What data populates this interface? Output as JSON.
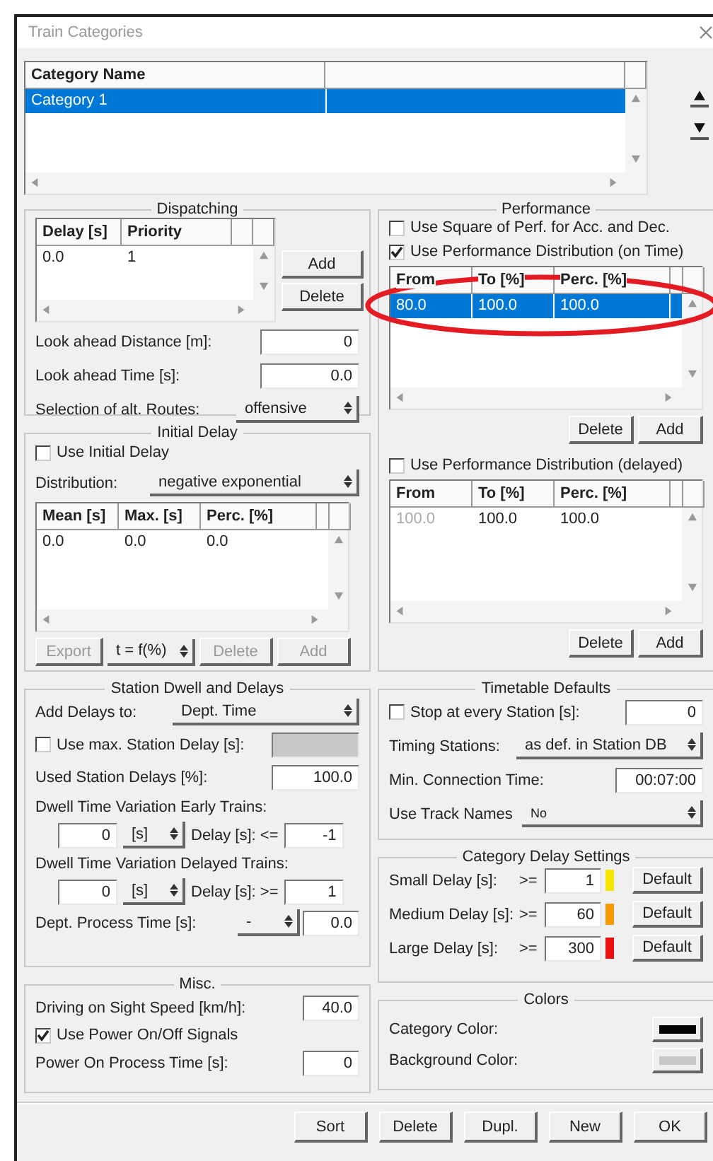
{
  "window": {
    "title": "Train Categories"
  },
  "categories": {
    "columns": [
      "Category Name"
    ],
    "rows": [
      {
        "cells": [
          "Category 1"
        ],
        "selected": true
      }
    ]
  },
  "dispatching": {
    "title": "Dispatching",
    "columns": [
      "Delay [s]",
      "Priority"
    ],
    "rows": [
      {
        "cells": [
          "0.0",
          "1"
        ],
        "selected": false
      }
    ],
    "buttons": [
      "Add",
      "Delete"
    ],
    "fields": [
      {
        "label": "Look ahead Distance [m]:",
        "value": "0"
      },
      {
        "label": "Look ahead Time [s]:",
        "value": "0.0"
      }
    ],
    "routes": {
      "label": "Selection of alt. Routes:",
      "value": "offensive"
    }
  },
  "initial_delay": {
    "title": "Initial Delay",
    "use": {
      "label": "Use Initial Delay",
      "checked": false
    },
    "distribution": {
      "label": "Distribution:",
      "value": "negative exponential"
    },
    "columns": [
      "Mean [s]",
      "Max. [s]",
      "Perc. [%]"
    ],
    "rows": [
      {
        "cells": [
          "0.0",
          "0.0",
          "0.0"
        ],
        "selected": false
      }
    ],
    "toolbar": [
      {
        "kind": "button",
        "label": "Export",
        "disabled": true
      },
      {
        "kind": "select",
        "label": "t = f(%)",
        "disabled": false
      },
      {
        "kind": "button",
        "label": "Delete",
        "disabled": true
      },
      {
        "kind": "button",
        "label": "Add",
        "disabled": true
      }
    ]
  },
  "performance": {
    "title": "Performance",
    "square": {
      "label": "Use Square of Perf. for Acc. and Dec.",
      "checked": false
    },
    "on_time": {
      "label": "Use Performance Distribution (on Time)",
      "checked": true,
      "columns": [
        "From",
        "To [%]",
        "Perc. [%]"
      ],
      "rows": [
        {
          "cells": [
            "80.0",
            "100.0",
            "100.0"
          ],
          "selected": true,
          "first_cell_disabled": false
        }
      ],
      "buttons": [
        "Delete",
        "Add"
      ]
    },
    "delayed": {
      "label": "Use Performance Distribution (delayed)",
      "checked": false,
      "columns": [
        "From",
        "To [%]",
        "Perc. [%]"
      ],
      "rows": [
        {
          "cells": [
            "100.0",
            "100.0",
            "100.0"
          ],
          "selected": false,
          "first_cell_disabled": true
        }
      ],
      "buttons": [
        "Delete",
        "Add"
      ]
    }
  },
  "station_dwell": {
    "title": "Station Dwell and Delays",
    "add_delays": {
      "label": "Add Delays to:",
      "value": "Dept. Time"
    },
    "max_delay": {
      "label": "Use max. Station Delay [s]:",
      "checked": false
    },
    "used": {
      "label": "Used Station Delays [%]:",
      "value": "100.0"
    },
    "variations": [
      {
        "label": "Dwell Time Variation Early Trains:",
        "value": "0",
        "unit": "[s]",
        "delay_label": "Delay [s]: <=",
        "delay_value": "-1"
      },
      {
        "label": "Dwell Time Variation Delayed Trains:",
        "value": "0",
        "unit": "[s]",
        "delay_label": "Delay [s]: >=",
        "delay_value": "1"
      }
    ],
    "process": {
      "label": "Dept. Process Time [s]:",
      "select": "-",
      "value": "0.0"
    }
  },
  "misc": {
    "title": "Misc.",
    "speed": {
      "label": "Driving on Sight Speed [km/h]:",
      "value": "40.0"
    },
    "power_signals": {
      "label": "Use Power On/Off Signals",
      "checked": true
    },
    "power_time": {
      "label": "Power On Process Time [s]:",
      "value": "0"
    }
  },
  "timetable": {
    "title": "Timetable Defaults",
    "stop": {
      "label": "Stop at every Station [s]:",
      "checked": false,
      "value": "0"
    },
    "timing": {
      "label": "Timing Stations:",
      "value": "as def. in Station DB"
    },
    "min_connection": {
      "label": "Min. Connection Time:",
      "value": "00:07:00"
    },
    "track_names": {
      "label": "Use Track Names",
      "value": "No"
    }
  },
  "delay_settings": {
    "title": "Category Delay Settings",
    "rows": [
      {
        "label": "Small Delay [s]:",
        "op": ">=",
        "value": "1",
        "color": "#f5e800",
        "button": "Default"
      },
      {
        "label": "Medium Delay [s]:",
        "op": ">=",
        "value": "60",
        "color": "#f59a00",
        "button": "Default"
      },
      {
        "label": "Large Delay [s]:",
        "op": ">=",
        "value": "300",
        "color": "#e81010",
        "button": "Default"
      }
    ]
  },
  "colors": {
    "title": "Colors",
    "items": [
      {
        "label": "Category Color:",
        "color": "#000000"
      },
      {
        "label": "Background Color:",
        "color": "#c8c8c8"
      }
    ]
  },
  "buttons": [
    "Sort",
    "Delete",
    "Dupl.",
    "New",
    "OK"
  ]
}
